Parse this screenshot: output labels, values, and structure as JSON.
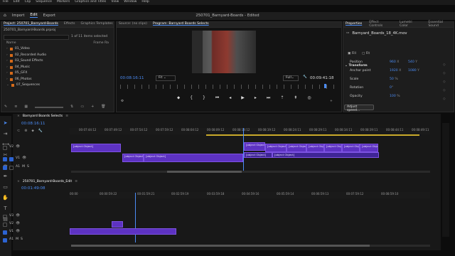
{
  "window": {
    "title": "250701_Barnyard-Boards - Edited"
  },
  "menu": [
    "File",
    "Edit",
    "Clip",
    "Sequence",
    "Markers",
    "Graphics and Titles",
    "View",
    "Window",
    "Help"
  ],
  "workspace_tabs": [
    {
      "label": "Import"
    },
    {
      "label": "Edit"
    },
    {
      "label": "Export"
    }
  ],
  "project": {
    "tabs": [
      "Project: 250701_Barnyard-Boards",
      "Effects",
      "Graphics Templates"
    ],
    "filename": "250701_Barnyard-Boards.prproj",
    "selected_count": "1 of 11 items selected",
    "column_name": "Name",
    "column_frame_rate": "Frame Ra",
    "items": [
      "01_Video",
      "02_Recorded Audio",
      "03_Sound Effects",
      "04_Music",
      "05_GFX",
      "06_Photos",
      "07_Sequences"
    ]
  },
  "source": {
    "tab": "Source: (no clips)"
  },
  "program": {
    "tab": "Program: Barnyard Boards Selects",
    "timecode_left": "00:08:16:11",
    "fit_label": "Fit",
    "quality": "Full",
    "timecode_right": "00:09:41:18"
  },
  "properties": {
    "tabs": [
      "Properties",
      "Effect Controls",
      "Lumetri Color",
      "Essential Sound"
    ],
    "clip_name": "Barnyard_Boards_18_4K.mov",
    "fill_label": "Fill",
    "fit_label": "Fit",
    "section": "Transform",
    "rows": [
      {
        "label": "Position",
        "v1": "960",
        "u1": "X",
        "v2": "540",
        "u2": "Y"
      },
      {
        "label": "Anchor point",
        "v1": "1920",
        "u1": "X",
        "v2": "1080",
        "u2": "Y"
      },
      {
        "label": "Scale",
        "v1": "50",
        "u1": "%"
      },
      {
        "label": "Rotation",
        "v1": "0",
        "u1": "°"
      },
      {
        "label": "Opacity",
        "v1": "100",
        "u1": "%"
      }
    ],
    "adjust_speed": "Adjust speed..."
  },
  "seq1": {
    "tab": "Barnyard Boards Selects",
    "timecode": "00:08:16:11",
    "ruler": [
      "00:07:44:12",
      "00:07:49:12",
      "00:07:54:12",
      "00:07:59:12",
      "00:08:04:12",
      "00:08:09:12",
      "00:08:14:12",
      "00:08:19:12",
      "00:08:24:11",
      "00:08:29:11",
      "00:08:34:11",
      "00:08:39:11",
      "00:08:44:11",
      "00:08:49:11"
    ],
    "tracks": [
      "V2",
      "V1",
      "A1"
    ],
    "clips": [
      {
        "label": "Barnyard_Boards_03_HD.mov"
      },
      {
        "label": "Barnyard_Boards_03_HD.mov"
      },
      {
        "label": "Barny"
      },
      {
        "label": "Barn"
      },
      {
        "label": "Barnyar"
      },
      {
        "label": "Barnyar"
      },
      {
        "label": "Barn"
      },
      {
        "label": "Barnyar"
      },
      {
        "label": "Barny"
      },
      {
        "label": "Barnyard_Boards_03_HD.mov"
      },
      {
        "label": "Barny"
      },
      {
        "label": "Barn"
      },
      {
        "label": "Barn"
      }
    ]
  },
  "seq2": {
    "tab": "250701_Barnyard-Boards_Edit",
    "timecode": "00:01:49:08",
    "ruler": [
      "00:00",
      "00:00:59:22",
      "00:01:59:21",
      "00:02:59:19",
      "00:03:59:18",
      "00:04:59:16",
      "00:05:59:14",
      "00:06:59:13",
      "00:07:59:12",
      "00:08:59:10"
    ],
    "tracks": [
      "V3",
      "V2",
      "V1",
      "A1"
    ]
  },
  "colors": {
    "accent": "#4b8cf5",
    "clip": "#5d32c2",
    "folder": "#d46a1a"
  }
}
